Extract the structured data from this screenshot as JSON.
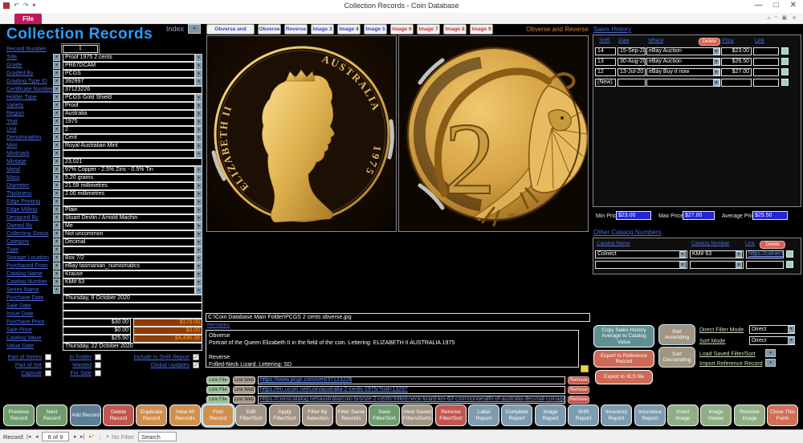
{
  "window": {
    "title": "Collection Records  -  Coin Database",
    "file_tab": "File",
    "minimize": "—",
    "maximize": "□",
    "close": "✕"
  },
  "colors": {
    "title_blue": "#2e9bff",
    "label_blue": "#4d6de0",
    "file_tab_pink": "#c2185b",
    "orange_field_bg": "#8f3c00",
    "orange_field_text": "#ffa127",
    "price_field_blue": "#2323d8",
    "delete_red": "#d9604f",
    "caption_orange": "#cf8440"
  },
  "header": {
    "form_title": "Collection Records",
    "index_label": "Index",
    "view_caption": "Obverse and Reverse"
  },
  "tabs": [
    {
      "label": "Obverse and Reverse",
      "style": "blue"
    },
    {
      "label": "Obverse",
      "style": "blue"
    },
    {
      "label": "Reverse",
      "style": "blue"
    },
    {
      "label": "Image 3",
      "style": "blue"
    },
    {
      "label": "Image 4",
      "style": "blue"
    },
    {
      "label": "Image 5",
      "style": "blue"
    },
    {
      "label": "Image 6",
      "style": "red"
    },
    {
      "label": "Image 7",
      "style": "red"
    },
    {
      "label": "Image 8",
      "style": "red"
    },
    {
      "label": "Image 9",
      "style": "red"
    }
  ],
  "fields": [
    {
      "label": "Record Number",
      "value": "1",
      "type": "record"
    },
    {
      "label": "Title",
      "value": "Proof 1975 2 cents",
      "type": "normal"
    },
    {
      "label": "Grade",
      "value": "PR67DCAM",
      "type": "normal"
    },
    {
      "label": "Graded By",
      "value": "PCGS",
      "type": "normal"
    },
    {
      "label": "Grading Type ID",
      "value": "392997",
      "type": "normal"
    },
    {
      "label": "Certificate Number",
      "value": "37123226",
      "type": "wide"
    },
    {
      "label": "Holder Type",
      "value": "PCGS Gold Shield",
      "type": "normal"
    },
    {
      "label": "Variety",
      "value": "Proof",
      "type": "normal"
    },
    {
      "label": "Region",
      "value": "Australia",
      "type": "normal"
    },
    {
      "label": "Year",
      "value": "1975",
      "type": "normal"
    },
    {
      "label": "Unit",
      "value": "2",
      "type": "normal"
    },
    {
      "label": "Denomination",
      "value": "Cent",
      "type": "normal"
    },
    {
      "label": "Mint",
      "value": "Royal Australian Mint",
      "type": "normal"
    },
    {
      "label": "Mintmark",
      "value": "",
      "type": "normal"
    },
    {
      "label": "Mintage",
      "value": "23,021",
      "type": "wide"
    },
    {
      "label": "Metal",
      "value": "97% Copper - 2.5% Zinc - 0.5% Tin",
      "type": "normal"
    },
    {
      "label": "Mass",
      "value": "5.20 grams",
      "type": "normal"
    },
    {
      "label": "Diameter",
      "value": "21.59 millimetres",
      "type": "normal"
    },
    {
      "label": "Thickness",
      "value": "2.00 millimetres",
      "type": "normal"
    },
    {
      "label": "Edge Printing",
      "value": "",
      "type": "normal"
    },
    {
      "label": "Edge Milling",
      "value": "Plain",
      "type": "normal"
    },
    {
      "label": "Designed By",
      "value": "Stuart Devlin / Arnold Machin",
      "type": "normal"
    },
    {
      "label": "Owned By",
      "value": "Me",
      "type": "normal"
    },
    {
      "label": "Collecting Status",
      "value": "Not uncommon",
      "type": "normal"
    },
    {
      "label": "Category",
      "value": "Decimal",
      "type": "normal"
    },
    {
      "label": "Type",
      "value": "",
      "type": "normal"
    },
    {
      "label": "Storage Location",
      "value": "Box 7/2",
      "type": "normal"
    },
    {
      "label": "Purchased From",
      "value": "eBay tasmanian_numismatics",
      "type": "normal"
    },
    {
      "label": "Catalog Name",
      "value": "Krause",
      "type": "normal"
    },
    {
      "label": "Catalog Number",
      "value": "KM# 63",
      "type": "normal"
    },
    {
      "label": "Series Name",
      "value": "",
      "type": "normal"
    },
    {
      "label": "Purchase Date",
      "value": "Thursday, 8 October 2020",
      "type": "date"
    },
    {
      "label": "Sale Date",
      "value": "",
      "type": "date"
    },
    {
      "label": "Issue Date",
      "value": "",
      "type": "date"
    }
  ],
  "money_rows": [
    {
      "label": "Purchase Price",
      "value": "$30.00",
      "alt_value": "$175.00"
    },
    {
      "label": "Sale Price",
      "value": "$0.00",
      "alt_value": "$0.00"
    },
    {
      "label": "Catalog Value",
      "value": "$25.50",
      "alt_value": "$4,436.38"
    }
  ],
  "value_date": {
    "label": "Value Date",
    "value": "Thursday, 22 October 2020"
  },
  "checkbox_cols": [
    {
      "items": [
        {
          "label": "Part of Series",
          "checked": false
        },
        {
          "label": "Part of Set",
          "checked": false
        },
        {
          "label": "Capsule",
          "checked": false
        }
      ]
    },
    {
      "items": [
        {
          "label": "In Folder",
          "checked": false
        },
        {
          "label": "Wanted",
          "checked": false
        },
        {
          "label": "For Sale",
          "checked": false
        }
      ]
    },
    {
      "items": [
        {
          "label": "Include in SHR Report",
          "checked": true
        },
        {
          "label": "Global Updates",
          "checked": true
        }
      ]
    }
  ],
  "coin_panel": {
    "obverse_legend_left": "ELIZABETH II",
    "obverse_legend_right": "AUSTRALIA",
    "obverse_year": "1975",
    "reverse_denomination": "2",
    "reverse_initials": "SD"
  },
  "image_path": "C:\\Coin Database Main Folder\\PCGS 2 cents obverse.jpg",
  "remarks": {
    "label": "Remarks",
    "text": "Obverse\nPortrait of the Queen Elizabeth II in the field of the coin. Lettering: ELIZABETH II AUSTRALIA 1975\n\nReverse\nFrilled-Neck Lizard. Lettering: SD"
  },
  "link_rows": {
    "file_label": "Link File",
    "web_label": "Link Web",
    "remove_label": "Remove",
    "urls": [
      "https://www.pcgs.com/cert/37123226",
      "https://en.ucoin.net/coin/australia-2-cents-1975/?cid=13297",
      "https://coinscatalog.net/australia/coin-bronze-2-cents-frilled-neck-lizard-km-63-commonwealth-of-australia-decimal-coinage"
    ]
  },
  "sales_history": {
    "title": "Sales History",
    "columns": {
      "shr": "SHR",
      "date": "Date",
      "where": "Where",
      "price": "Price",
      "link": "Link"
    },
    "delete_label": "Delete",
    "rows": [
      {
        "shr": "14",
        "date": "15-Sep-20",
        "where": "eBay Auction",
        "price": "$23.00",
        "link": ""
      },
      {
        "shr": "13",
        "date": "30-Aug-20",
        "where": "eBay Auction",
        "price": "$26.50",
        "link": ""
      },
      {
        "shr": "12",
        "date": "13-Jul-20",
        "where": "eBay Buy it now",
        "price": "$27.00",
        "link": ""
      },
      {
        "shr": "(New)",
        "date": "",
        "where": "",
        "price": "",
        "link": ""
      }
    ],
    "min_label": "Min Price:",
    "min": "$23.00",
    "max_label": "Max Price:",
    "max": "$27.00",
    "avg_label": "Average Price:",
    "avg": "$25.50"
  },
  "other_catalogs": {
    "title": "Other Catalog Numbers",
    "columns": {
      "name": "Catalog Name",
      "number": "Catalog Number",
      "link": "Link"
    },
    "delete_label": "Delete",
    "rows": [
      {
        "name": "Colnect",
        "number": "KM# 63",
        "link": "https://colnect.c"
      },
      {
        "name": "",
        "number": "",
        "link": ""
      }
    ]
  },
  "actions": {
    "copy_avg": "Copy Sales History Average to Catalog Value",
    "sort_asc": "Sort Ascending",
    "sort_desc": "Sort Descending",
    "export_ref": "Export to Reference Record",
    "export_xls": "Export to XLS file",
    "direct_filter_mode_label": "Direct Filter Mode",
    "direct_filter_mode_value": "Direct",
    "sort_mode_label": "Sort Mode",
    "sort_mode_value": "Direct",
    "load_saved_label": "Load Saved Filter/Sort",
    "import_ref_label": "Import Reference Record"
  },
  "bottom_buttons": [
    {
      "label": "Previous Record",
      "color": "green"
    },
    {
      "label": "Next Record",
      "color": "green"
    },
    {
      "label": "Add Record",
      "color": "slate"
    },
    {
      "label": "Delete Record",
      "color": "red"
    },
    {
      "label": "Duplicate Record",
      "color": "orange"
    },
    {
      "label": "View All Records",
      "color": "orange"
    },
    {
      "label": "Find Record",
      "color": "orange",
      "focus": true
    },
    {
      "label": "Edit Filter/Sort",
      "color": "taupe"
    },
    {
      "label": "Apply Filter/Sort",
      "color": "taupe"
    },
    {
      "label": "Filter By Selection",
      "color": "taupe"
    },
    {
      "label": "Filter Same Records",
      "color": "taupe"
    },
    {
      "label": "Save Filter/Sort",
      "color": "green"
    },
    {
      "label": "View Saved Filters/Sorts",
      "color": "taupe"
    },
    {
      "label": "Remove Filter/Sort",
      "color": "red"
    },
    {
      "label": "Label Report",
      "color": "blue"
    },
    {
      "label": "Complete Report",
      "color": "blue"
    },
    {
      "label": "Image Report",
      "color": "blue"
    },
    {
      "label": "SHR Report",
      "color": "blue"
    },
    {
      "label": "Inventory Report",
      "color": "blue"
    },
    {
      "label": "Insurance Report",
      "color": "blue"
    },
    {
      "label": "Insert Image",
      "color": "sage"
    },
    {
      "label": "Image Viewer",
      "color": "sage"
    },
    {
      "label": "Remove Image",
      "color": "sage"
    },
    {
      "label": "Close This Form",
      "color": "salmon"
    }
  ],
  "status_bar": {
    "record_label": "Record:",
    "position": "8 of 9",
    "no_filter": "No Filter",
    "search_placeholder": "Search"
  }
}
